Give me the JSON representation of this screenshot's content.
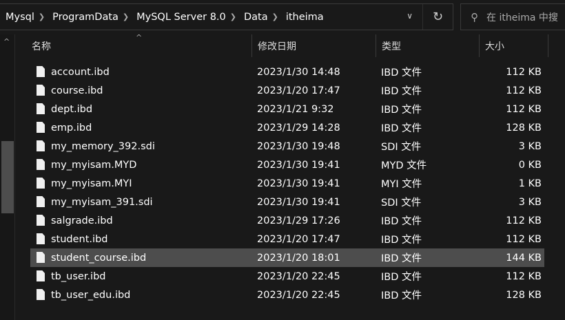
{
  "breadcrumb": [
    "Mysql",
    "ProgramData",
    "MySQL Server 8.0",
    "Data",
    "itheima"
  ],
  "search": {
    "placeholder": "在 itheima 中搜"
  },
  "columns": {
    "name": "名称",
    "date": "修改日期",
    "type": "类型",
    "size": "大小"
  },
  "files": [
    {
      "name": "account.ibd",
      "date": "2023/1/30 14:48",
      "type": "IBD 文件",
      "size": "112 KB"
    },
    {
      "name": "course.ibd",
      "date": "2023/1/20 17:47",
      "type": "IBD 文件",
      "size": "112 KB"
    },
    {
      "name": "dept.ibd",
      "date": "2023/1/21 9:32",
      "type": "IBD 文件",
      "size": "112 KB"
    },
    {
      "name": "emp.ibd",
      "date": "2023/1/29 14:28",
      "type": "IBD 文件",
      "size": "128 KB"
    },
    {
      "name": "my_memory_392.sdi",
      "date": "2023/1/30 19:48",
      "type": "SDI 文件",
      "size": "3 KB"
    },
    {
      "name": "my_myisam.MYD",
      "date": "2023/1/30 19:41",
      "type": "MYD 文件",
      "size": "0 KB"
    },
    {
      "name": "my_myisam.MYI",
      "date": "2023/1/30 19:41",
      "type": "MYI 文件",
      "size": "1 KB"
    },
    {
      "name": "my_myisam_391.sdi",
      "date": "2023/1/30 19:41",
      "type": "SDI 文件",
      "size": "3 KB"
    },
    {
      "name": "salgrade.ibd",
      "date": "2023/1/29 17:26",
      "type": "IBD 文件",
      "size": "112 KB"
    },
    {
      "name": "student.ibd",
      "date": "2023/1/20 17:47",
      "type": "IBD 文件",
      "size": "112 KB"
    },
    {
      "name": "student_course.ibd",
      "date": "2023/1/20 18:01",
      "type": "IBD 文件",
      "size": "144 KB",
      "selected": true
    },
    {
      "name": "tb_user.ibd",
      "date": "2023/1/20 22:45",
      "type": "IBD 文件",
      "size": "112 KB"
    },
    {
      "name": "tb_user_edu.ibd",
      "date": "2023/1/20 22:45",
      "type": "IBD 文件",
      "size": "128 KB"
    }
  ]
}
